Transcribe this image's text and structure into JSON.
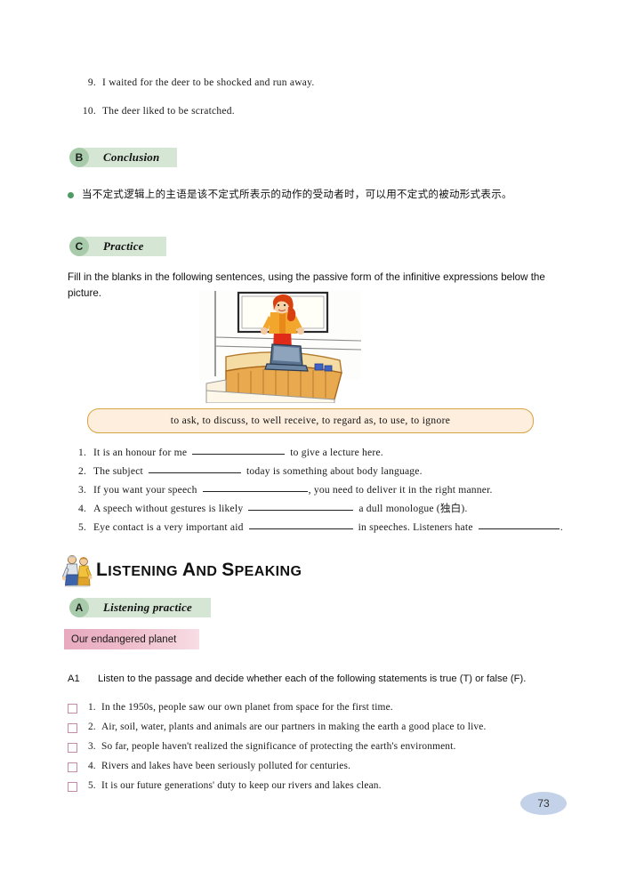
{
  "page": {
    "number": "73"
  },
  "top_list": {
    "items": [
      {
        "num": "9.",
        "text": "I waited for the deer to be shocked and run away."
      },
      {
        "num": "10.",
        "text": "The deer liked to be scratched."
      }
    ]
  },
  "section_b": {
    "letter": "B",
    "label": "Conclusion",
    "rule_text": "当不定式逻辑上的主语是该不定式所表示的动作的受动者时，可以用不定式的被动形式表示。",
    "bullet_color": "#4d9b62"
  },
  "section_c": {
    "letter": "C",
    "label": "Practice",
    "instruction": "Fill in the blanks in the following sentences, using the passive form of the infinitive expressions below the picture.",
    "word_bank": "to ask,  to discuss,  to well receive,  to regard as,  to use,  to ignore",
    "word_bank_border": "#d8a441",
    "word_bank_fill": "#fdeedd",
    "exercises": [
      {
        "num": "1.",
        "before": "It is an honour for me",
        "after": "to give a lecture here.",
        "blank": "b-md"
      },
      {
        "num": "2.",
        "before": "The subject",
        "after": "today is something about body language.",
        "blank": "b-md"
      },
      {
        "num": "3.",
        "before": "If you want your speech",
        "after": ", you need to deliver it in the right manner.",
        "blank": "b-lg"
      },
      {
        "num": "4.",
        "before": "A speech without gestures is likely",
        "after": "a dull monologue (独白).",
        "blank": "b-lg"
      },
      {
        "num": "5.",
        "before": "Eye contact is a very important aid",
        "mid": "in speeches. Listeners hate",
        "after": ".",
        "blank": "b-lg",
        "blank2": "b-sm"
      }
    ]
  },
  "listening_section": {
    "title_first_letter": "L",
    "title": "ISTENING ",
    "title_and_cap": "A",
    "title_and": "ND ",
    "title_speak_cap": "S",
    "title_speak": "PEAKING",
    "full_title": "LISTENING AND SPEAKING",
    "icon_name": "two-people-talking-icon"
  },
  "section_a": {
    "letter": "A",
    "label": "Listening practice",
    "topic": "Our endangered planet",
    "topic_color": "#e8a9bf"
  },
  "a1": {
    "tag": "A1",
    "instruction": "Listen to the passage and decide whether each of the following statements is true (T) or false (F).",
    "statements": [
      {
        "num": "1.",
        "text": "In the 1950s, people saw our own planet from space for the first time."
      },
      {
        "num": "2.",
        "text": "Air, soil, water, plants and animals are our partners in making the earth a good place to live."
      },
      {
        "num": "3.",
        "text": "So far, people haven't realized the significance of protecting the earth's environment."
      },
      {
        "num": "4.",
        "text": "Rivers and lakes have been seriously polluted for centuries."
      },
      {
        "num": "5.",
        "text": "It is our future generations' duty to keep our rivers and lakes clean."
      }
    ],
    "checkbox_color": "#c58ba8"
  },
  "illustration": {
    "name": "woman-giving-lecture-at-podium",
    "description": "Cartoon of a red-haired woman in an orange jacket and red skirt speaking behind a wooden podium with a laptop, whiteboard behind her"
  }
}
